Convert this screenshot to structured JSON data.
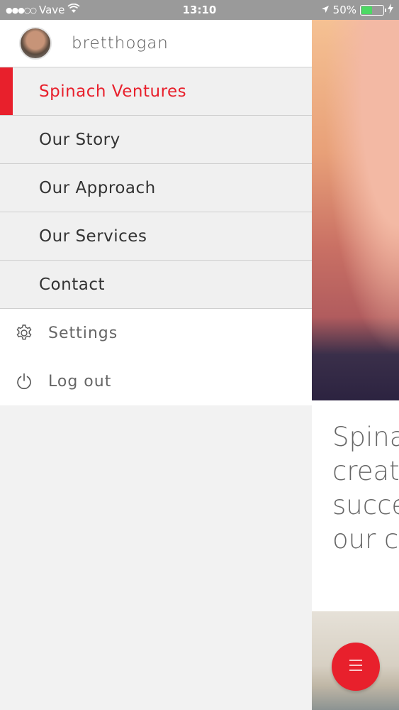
{
  "status_bar": {
    "carrier": "Vave",
    "time": "13:10",
    "battery": "50%",
    "battery_level": 0.5
  },
  "drawer": {
    "username": "bretthogan",
    "nav_items": [
      {
        "label": "Spinach Ventures",
        "active": true
      },
      {
        "label": "Our Story"
      },
      {
        "label": "Our Approach"
      },
      {
        "label": "Our Services"
      },
      {
        "label": "Contact"
      }
    ],
    "settings_label": "Settings",
    "logout_label": "Log out"
  },
  "content": {
    "intro_lines": [
      "Spina",
      "creat",
      "succe",
      "our c"
    ]
  },
  "colors": {
    "accent": "#e8202c",
    "statusbar": "#9a9a9a"
  },
  "icons": {
    "settings": "gear-icon",
    "logout": "power-icon",
    "menu": "hamburger-icon"
  }
}
